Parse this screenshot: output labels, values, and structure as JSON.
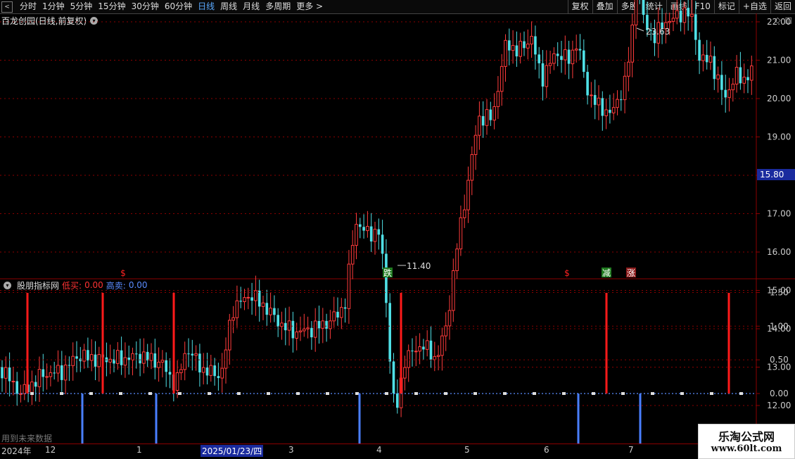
{
  "toolbar": {
    "periods": [
      "分时",
      "1分钟",
      "5分钟",
      "15分钟",
      "30分钟",
      "60分钟",
      "日线",
      "周线",
      "月线",
      "多周期",
      "更多 >"
    ],
    "active_period": "日线",
    "tools": [
      "复权",
      "叠加",
      "多股",
      "统计",
      "画线",
      "F10",
      "标记",
      "+自选",
      "返回"
    ]
  },
  "stock_title": "百龙创园(日线,前复权)",
  "price_panel": {
    "price_ticks": [
      "22.00",
      "21.00",
      "20.00",
      "19.00",
      "18.00",
      "17.00",
      "16.00",
      "15.00",
      "14.00",
      "13.00",
      "12.00"
    ],
    "current_price": "15.80",
    "high_label": "23.63",
    "low_label": "11.40",
    "signals": [
      {
        "text": "$",
        "color": "#ff2222",
        "bg": ""
      },
      {
        "text": "跌",
        "color": "#ffffff",
        "bg": "#1f7a1f"
      },
      {
        "text": "$",
        "color": "#ff2222",
        "bg": ""
      },
      {
        "text": "减",
        "color": "#ffffff",
        "bg": "#1f7a1f"
      },
      {
        "text": "涨",
        "color": "#ffffff",
        "bg": "#8b1a1a"
      }
    ]
  },
  "indicator": {
    "name": "股朋指标网",
    "low_buy_label": "低买:",
    "low_buy_value": "0.00",
    "high_sell_label": "高卖:",
    "high_sell_value": "0.00",
    "ticks": [
      "1.50",
      "1.00",
      "0.50",
      "0.00"
    ]
  },
  "future_note": "用到未来数据",
  "date_axis": {
    "labels": [
      "2024年",
      "12",
      "1",
      "2025/01/23/四",
      "3",
      "4",
      "5",
      "6",
      "7"
    ],
    "highlight": "2025/01/23/四"
  },
  "watermark": {
    "line1": "乐淘公式网",
    "line2": "www.60lt.com"
  },
  "colors": {
    "up": "#ff3b3b",
    "down": "#4fe0e6",
    "buy_bar": "#ff1a1a",
    "sell_bar": "#4a7fff",
    "grid": "#8b0000"
  }
}
